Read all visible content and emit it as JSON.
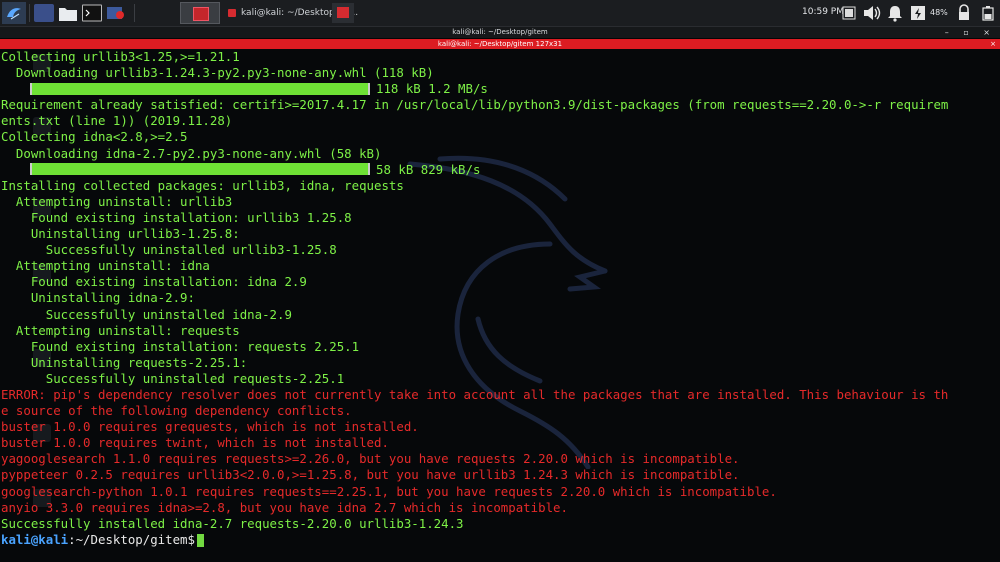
{
  "taskbar": {
    "clock": "10:59 PM",
    "battery": "48%",
    "task_window_label": "kali@kali: ~/Desktop/git..."
  },
  "window": {
    "title": "kali@kali: ~/Desktop/gitem",
    "tab_title": "kali@kali: ~/Desktop/gitem 127x31",
    "controls": "– ▫ ×"
  },
  "terminal": {
    "lines": [
      {
        "cls": "ok",
        "text": "Collecting urllib3<1.25,>=1.21.1"
      },
      {
        "cls": "ok",
        "text": "  Downloading urllib3-1.24.3-py2.py3-none-any.whl (118 kB)"
      },
      {
        "cls": "ok",
        "bar": true,
        "text": "118 kB 1.2 MB/s"
      },
      {
        "cls": "ok",
        "text": "Requirement already satisfied: certifi>=2017.4.17 in /usr/local/lib/python3.9/dist-packages (from requests==2.20.0->-r requirem"
      },
      {
        "cls": "ok",
        "text": "ents.txt (line 1)) (2019.11.28)"
      },
      {
        "cls": "ok",
        "text": "Collecting idna<2.8,>=2.5"
      },
      {
        "cls": "ok",
        "text": "  Downloading idna-2.7-py2.py3-none-any.whl (58 kB)"
      },
      {
        "cls": "ok",
        "bar": true,
        "text": "58 kB 829 kB/s"
      },
      {
        "cls": "ok",
        "text": "Installing collected packages: urllib3, idna, requests"
      },
      {
        "cls": "ok",
        "text": "  Attempting uninstall: urllib3"
      },
      {
        "cls": "ok",
        "text": "    Found existing installation: urllib3 1.25.8"
      },
      {
        "cls": "ok",
        "text": "    Uninstalling urllib3-1.25.8:"
      },
      {
        "cls": "ok",
        "text": "      Successfully uninstalled urllib3-1.25.8"
      },
      {
        "cls": "ok",
        "text": "  Attempting uninstall: idna"
      },
      {
        "cls": "ok",
        "text": "    Found existing installation: idna 2.9"
      },
      {
        "cls": "ok",
        "text": "    Uninstalling idna-2.9:"
      },
      {
        "cls": "ok",
        "text": "      Successfully uninstalled idna-2.9"
      },
      {
        "cls": "ok",
        "text": "  Attempting uninstall: requests"
      },
      {
        "cls": "ok",
        "text": "    Found existing installation: requests 2.25.1"
      },
      {
        "cls": "ok",
        "text": "    Uninstalling requests-2.25.1:"
      },
      {
        "cls": "ok",
        "text": "      Successfully uninstalled requests-2.25.1"
      },
      {
        "cls": "err",
        "text": "ERROR: pip's dependency resolver does not currently take into account all the packages that are installed. This behaviour is th"
      },
      {
        "cls": "err",
        "text": "e source of the following dependency conflicts."
      },
      {
        "cls": "err",
        "text": "buster 1.0.0 requires grequests, which is not installed."
      },
      {
        "cls": "err",
        "text": "buster 1.0.0 requires twint, which is not installed."
      },
      {
        "cls": "err",
        "text": "yagooglesearch 1.1.0 requires requests>=2.26.0, but you have requests 2.20.0 which is incompatible."
      },
      {
        "cls": "err",
        "text": "pyppeteer 0.2.5 requires urllib3<2.0.0,>=1.25.8, but you have urllib3 1.24.3 which is incompatible."
      },
      {
        "cls": "err",
        "text": "googlesearch-python 1.0.1 requires requests==2.25.1, but you have requests 2.20.0 which is incompatible."
      },
      {
        "cls": "err",
        "text": "anyio 3.3.0 requires idna>=2.8, but you have idna 2.7 which is incompatible."
      },
      {
        "cls": "ok",
        "text": "Successfully installed idna-2.7 requests-2.20.0 urllib3-1.24.3"
      }
    ],
    "prompt": {
      "user": "kali@kali",
      "path": ":~/Desktop/gitem$"
    }
  },
  "colors": {
    "output_green": "#7ef147",
    "error_red": "#e62a2a",
    "prompt_blue": "#4aa3ff",
    "tab_red": "#dc1c22"
  },
  "icons": [
    "kali-menu-icon",
    "terminal-icon",
    "folder-icon",
    "terminal-app-icon",
    "screen-recorder-icon",
    "workspace-icon",
    "speaker-icon",
    "notification-bell-icon",
    "power-icon",
    "battery-icon",
    "lock-icon",
    "dragon-logo-icon"
  ]
}
